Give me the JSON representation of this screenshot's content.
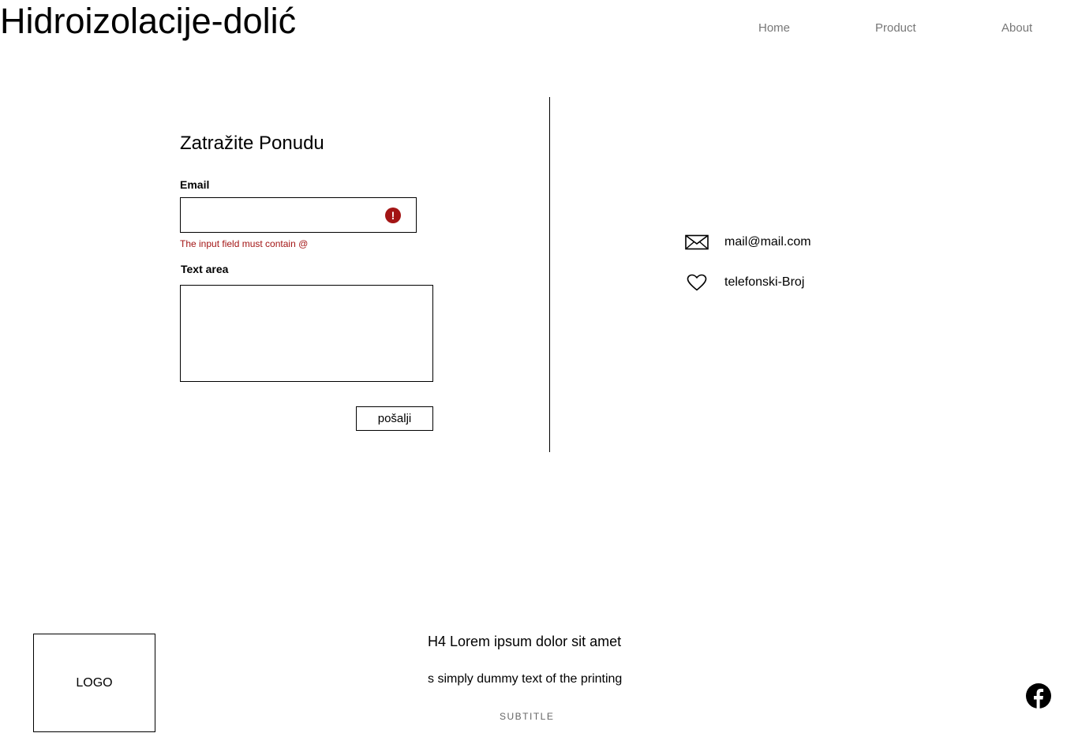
{
  "header": {
    "site_title": "Hidroizolacije-dolić",
    "nav": [
      "Home",
      "Product",
      "About"
    ]
  },
  "form": {
    "title": "Zatražite Ponudu",
    "email_label": "Email",
    "email_value": "",
    "error_icon": "!",
    "error_message": "The input field must contain @",
    "textarea_label": "Text area",
    "textarea_value": "",
    "submit_label": "pošalji"
  },
  "contact": {
    "email": "mail@mail.com",
    "email_icon": "envelope-icon",
    "phone": "telefonski-Broj",
    "phone_icon": "heart-icon"
  },
  "footer": {
    "logo": "LOGO",
    "heading": "H4 Lorem ipsum dolor sit amet",
    "text": "s simply dummy text of the printing",
    "subtitle": "SUBTITLE",
    "social_icon": "facebook-icon"
  },
  "colors": {
    "error": "#a31515",
    "nav_text": "#777777",
    "subtitle_text": "#666666"
  }
}
